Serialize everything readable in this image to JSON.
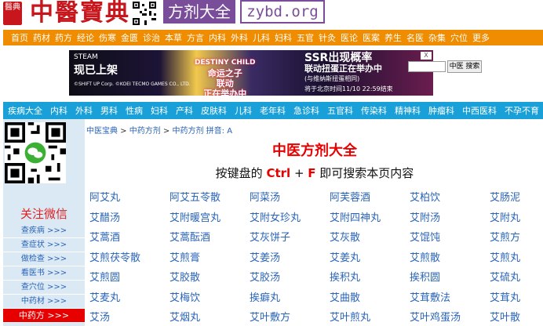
{
  "header": {
    "logo_text": "醫典",
    "brand": "中醫寶典",
    "site_tag": "方剂大全",
    "site_domain": "zybd.org"
  },
  "top_nav": [
    "首页",
    "药材",
    "药方",
    "经论",
    "伤寒",
    "金匮",
    "诊治",
    "本草",
    "方言",
    "内科",
    "外科",
    "儿科",
    "妇科",
    "五官",
    "针灸",
    "医论",
    "医案",
    "养生",
    "名医",
    "杂集",
    "穴位",
    "更多"
  ],
  "banner": {
    "left_line1": "STEAM",
    "left_big": "现已上架",
    "left_small": "©SHIFT UP Corp. ©KOEI TECMO GAMES CO., LTD.",
    "mid_line1": "命运之子",
    "mid_line2": "联动",
    "mid_line3": "正在举办中",
    "mid_logo": "DESTINY CHILD",
    "right_line1": "SSR出现概率",
    "right_line2": "联动扭蛋正在举办中",
    "right_small": "(与维纳斯扭蛋相同)",
    "right_time": "将于北京时间11/10 22:59结束",
    "ad_close": "X",
    "search_placeholder": "",
    "search_button": "中医 搜索"
  },
  "category_nav": [
    "疾病大全",
    "内科",
    "外科",
    "男科",
    "性病",
    "妇科",
    "产科",
    "皮肤科",
    "儿科",
    "老年科",
    "急诊科",
    "五官科",
    "传染科",
    "精神科",
    "肿瘤科",
    "中西医科",
    "不孕不育"
  ],
  "sidebar": {
    "wechat_label": "关注微信",
    "links": [
      {
        "label": "查疾病 >>>",
        "active": false
      },
      {
        "label": "查症状 >>>",
        "active": false
      },
      {
        "label": "做检查 >>>",
        "active": false
      },
      {
        "label": "看医书 >>>",
        "active": false
      },
      {
        "label": "查穴位 >>>",
        "active": false
      },
      {
        "label": "中药材 >>>",
        "active": false
      },
      {
        "label": "中药方 >>>",
        "active": true
      }
    ]
  },
  "breadcrumb": {
    "items": [
      "中医宝典",
      "中药方剂",
      "中药方剂 拼音: A"
    ],
    "separator": " > "
  },
  "main": {
    "title": "中医方剂大全",
    "hint_prefix": "按键盘的 ",
    "hint_key1": "Ctrl",
    "hint_plus": " + ",
    "hint_key2": "F",
    "hint_suffix": " 即可搜索本页内容"
  },
  "formulas": [
    "阿艾丸",
    "阿艾五苓散",
    "阿菜汤",
    "阿芙蓉酒",
    "艾柏饮",
    "艾肠泥",
    "艾醋汤",
    "艾附暖宫丸",
    "艾附女珍丸",
    "艾附四神丸",
    "艾附汤",
    "艾附丸",
    "艾蒿酒",
    "艾蒿酝酒",
    "艾灰饼子",
    "艾灰散",
    "艾馄饨",
    "艾煎方",
    "艾煎茯苓散",
    "艾煎膏",
    "艾姜汤",
    "艾姜丸",
    "艾煎散",
    "艾煎丸",
    "艾煎圆",
    "艾胶散",
    "艾胶汤",
    "挨积丸",
    "挨积圆",
    "艾硫丸",
    "艾麦丸",
    "艾梅饮",
    "挨癖丸",
    "艾曲散",
    "艾茸敷法",
    "艾茸丸",
    "艾汤",
    "艾烟丸",
    "艾叶敷方",
    "艾叶煎丸",
    "艾叶鸡蛋汤",
    "艾叶散"
  ]
}
